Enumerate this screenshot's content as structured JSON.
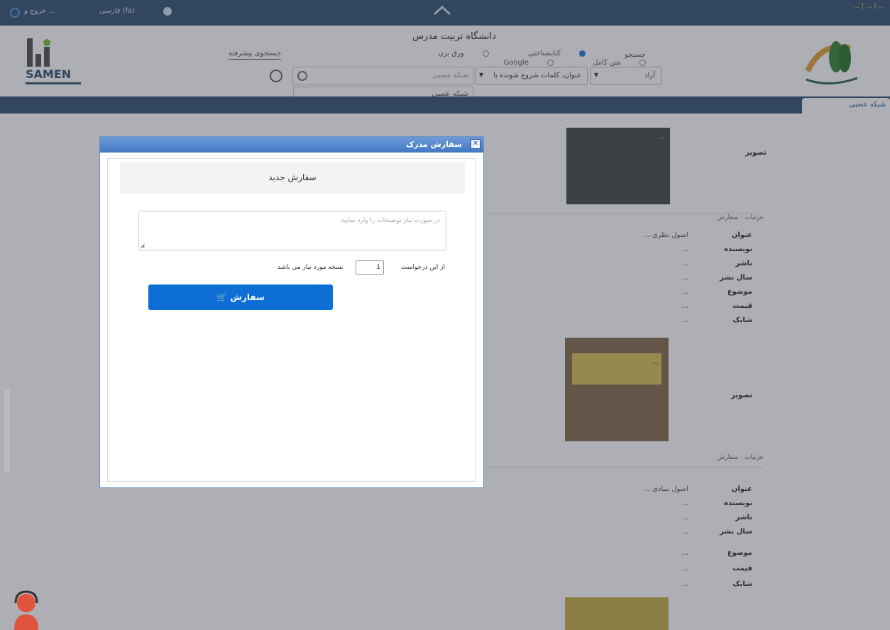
{
  "topbar": {
    "logout": "خروج و ...",
    "lang": "فارسی (fa)",
    "ip": "...",
    "links": "... | ... | ..."
  },
  "header": {
    "university": "دانشگاه تربیت مدرس",
    "advanced": "جستجوی پیشرفته",
    "radios": [
      {
        "label": "جستجو",
        "on": false
      },
      {
        "label": "کتابشناختی",
        "on": true
      },
      {
        "label": "ورق بزن",
        "on": false
      },
      {
        "label": "متن کامل",
        "on": false
      },
      {
        "label": "Google",
        "on": false
      }
    ],
    "search_placeholder": "شبکه عصبی",
    "field_select": "عنوان، کلمات شروع شونده با",
    "type_select": "آزاد",
    "dropdown": "شبکه عصبی"
  },
  "navtab": "شبکه عصبی",
  "results": {
    "labels": {
      "title": "عنوان",
      "author": "نویسنده",
      "publisher": "ناشر",
      "year": "سال نشر",
      "subject": "موضوع",
      "price": "قیمت",
      "isbn": "شابک",
      "image": "تصویر"
    },
    "tabs": "جزئیات · سفارش",
    "item1": {
      "title": "اصول نظری ...",
      "author": "...",
      "publisher": "...",
      "year": "...",
      "subject": "...",
      "price": "...",
      "isbn": "...",
      "cover_title": "..."
    },
    "item2": {
      "title": "اصول بنیادی ...",
      "author": "...",
      "publisher": "...",
      "year": "...",
      "subject": "...",
      "price": "...",
      "isbn": "...",
      "cover_title": "..."
    }
  },
  "dialog": {
    "title": "سفارش مدرک",
    "heading": "سفارش جدید",
    "textarea_placeholder": "در صورت نیاز توضیحات را وارد نمایید",
    "qty_prefix": "از این درخواست",
    "qty_value": "1",
    "qty_suffix": "نسخه مورد نیاز می باشد",
    "order_button": "سفارش"
  }
}
